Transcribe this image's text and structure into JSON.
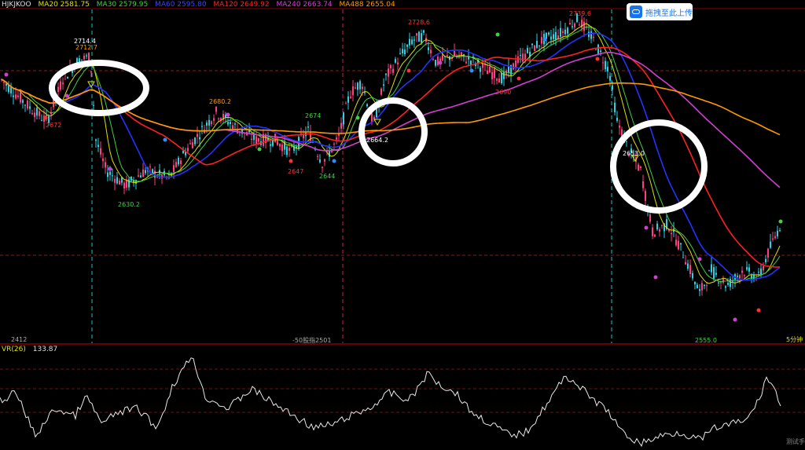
{
  "legend": {
    "symbol": "HJKJKOO",
    "items": [
      {
        "label": "MA20 2581.75",
        "color": "#e0e000"
      },
      {
        "label": "MA30 2579.95",
        "color": "#40d040"
      },
      {
        "label": "MA60 2595.80",
        "color": "#2233ff"
      },
      {
        "label": "MA120 2649.92",
        "color": "#ff2020"
      },
      {
        "label": "MA240 2663.74",
        "color": "#d040d0"
      },
      {
        "label": "MA488 2655.04",
        "color": "#ff9900"
      }
    ]
  },
  "upload_button": {
    "label": "拖拽至此上传",
    "icon": "cloud-upload-icon"
  },
  "bottom_labels": {
    "left": "2412",
    "mid": "-50股指2501",
    "right": "5分钟"
  },
  "vr": {
    "name": "VR(26)",
    "value": "133.87"
  },
  "corner_label": "测试手",
  "chart_data": {
    "type": "candlestick",
    "title": "",
    "price_range": [
      2530,
      2745
    ],
    "annotations": [
      {
        "text": "2714.4",
        "color": "#ffffff"
      },
      {
        "text": "2712.7",
        "color": "#ff9900"
      },
      {
        "text": "2672",
        "color": "#ff3030"
      },
      {
        "text": "2630.2",
        "color": "#40d040"
      },
      {
        "text": "2680.2",
        "color": "#ff9900"
      },
      {
        "text": "2674",
        "color": "#40d040"
      },
      {
        "text": "2647",
        "color": "#ff3030"
      },
      {
        "text": "2644",
        "color": "#40d040"
      },
      {
        "text": "2664.2",
        "color": "#ffffff"
      },
      {
        "text": "2728.6",
        "color": "#ff3030"
      },
      {
        "text": "2690",
        "color": "#ff3030"
      },
      {
        "text": "2739.6",
        "color": "#ff3030"
      },
      {
        "text": "2653.0",
        "color": "#ffffff"
      },
      {
        "text": "2555.0",
        "color": "#40d040"
      }
    ],
    "grid": true,
    "vr_range": [
      0,
      300
    ]
  }
}
